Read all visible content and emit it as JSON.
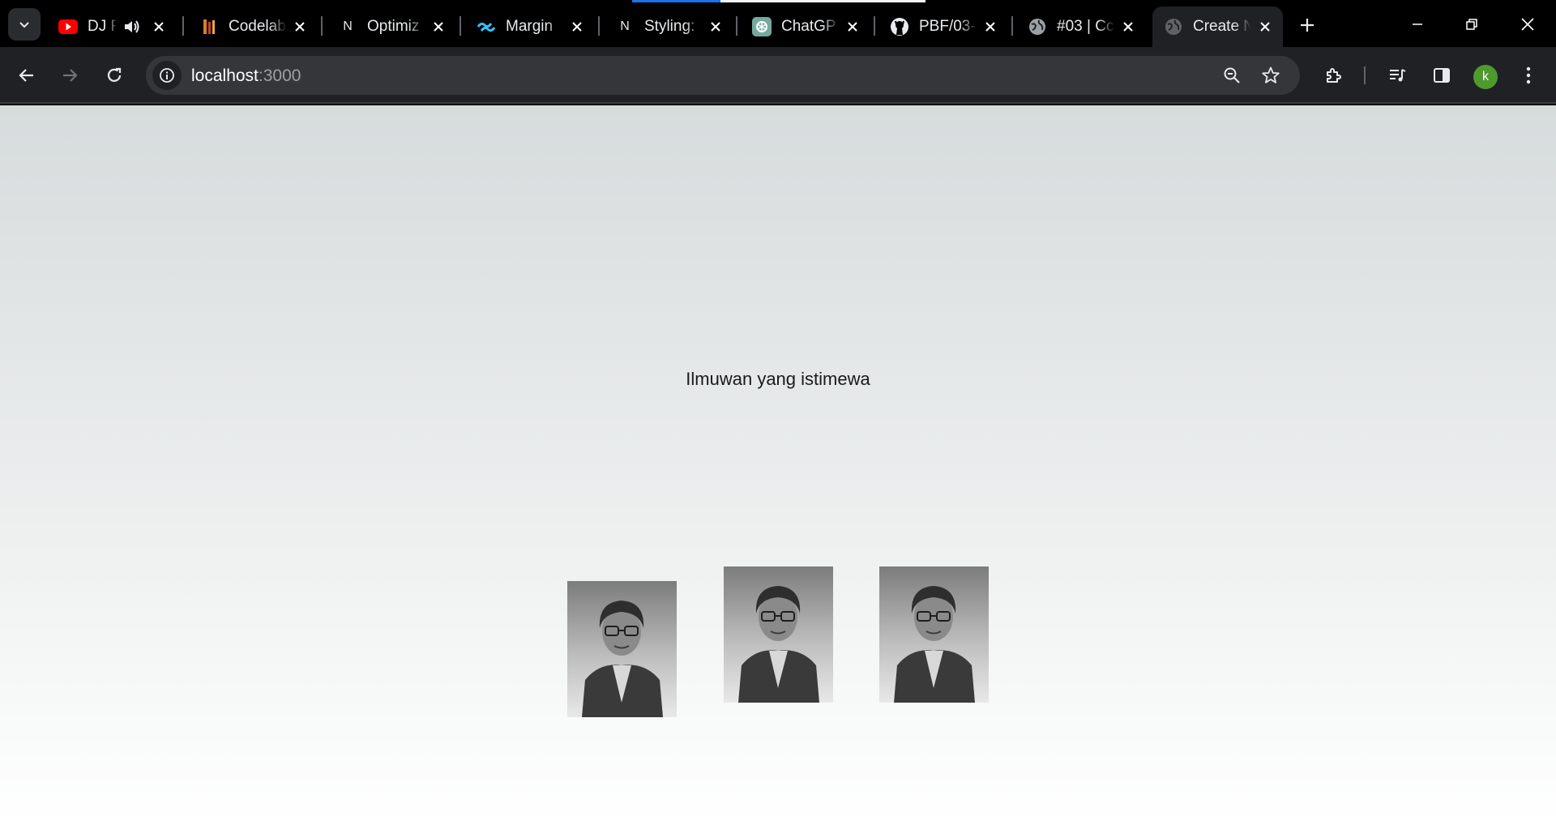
{
  "tabs": [
    {
      "title": "DJ F",
      "icon": "youtube-icon",
      "muted_icon": "speaker-icon"
    },
    {
      "title": "Codelab",
      "icon": "codelab-icon"
    },
    {
      "title": "Optimiz",
      "icon": "nextjs-icon"
    },
    {
      "title": "Margin",
      "icon": "tailwind-icon"
    },
    {
      "title": "Styling:",
      "icon": "nextjs-icon",
      "loading": 0.3
    },
    {
      "title": "ChatGP",
      "icon": "chatgpt-icon"
    },
    {
      "title": "PBF/03-",
      "icon": "github-icon"
    },
    {
      "title": "#03 | Cc",
      "icon": "globe-icon"
    },
    {
      "title": "Create N",
      "icon": "globe-icon",
      "active": true
    }
  ],
  "toolbar": {
    "url_host": "localhost",
    "url_port": ":3000",
    "profile_initial": "k"
  },
  "page": {
    "heading": "Ilmuwan yang istimewa",
    "photos": [
      {
        "alt": "portrait-1"
      },
      {
        "alt": "portrait-2"
      },
      {
        "alt": "portrait-3"
      }
    ]
  },
  "colors": {
    "chrome_bg": "#000000",
    "toolbar_bg": "#202124",
    "omnibox_bg": "#35363a",
    "avatar": "#4e9a2f",
    "page_bg_top": "#d6dbdc",
    "page_bg_bottom": "#ffffff"
  }
}
